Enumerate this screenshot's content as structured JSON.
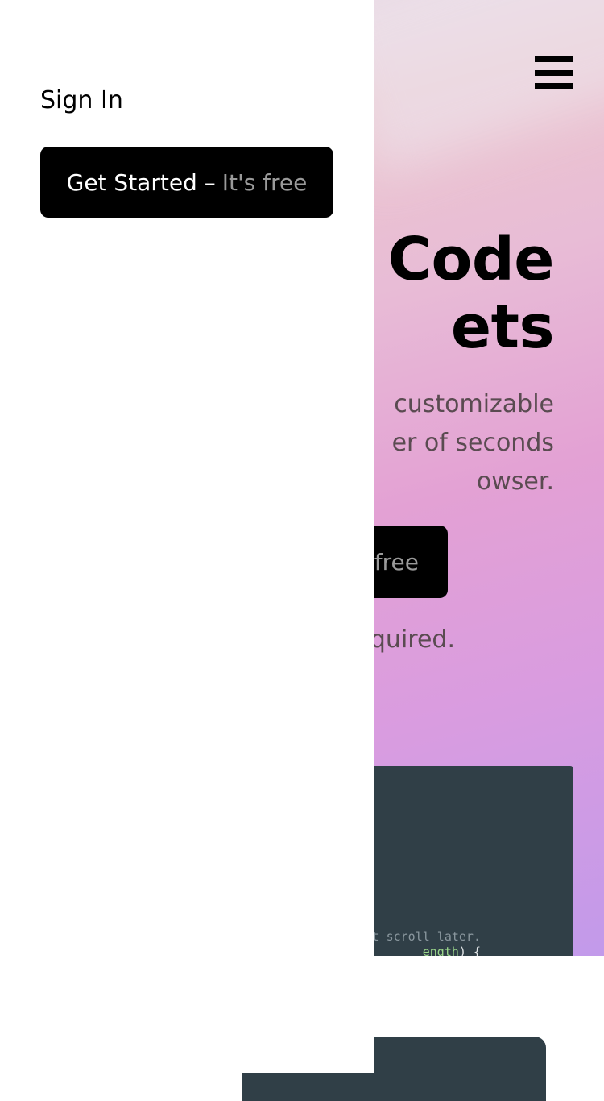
{
  "nav": {
    "menu_icon": "hamburger-menu-icon",
    "sign_in_label": "Sign In",
    "cta_main": "Get Started –",
    "cta_muted": "It's free"
  },
  "hero": {
    "title_line1": "Code",
    "title_line2": "ets",
    "subtitle_line1": "customizable",
    "subtitle_line2": "er of seconds",
    "subtitle_line3": "owser.",
    "cta_muted": "free",
    "note": "quired."
  },
  "code_preview": {
    "comment": "st scroll later.",
    "expr_prop": "ength",
    "expr_rest": ") {"
  },
  "colors": {
    "panel_bg": "#ffffff",
    "button_bg": "#000000",
    "button_muted_text": "#9a9a9a",
    "code_bg": "#303f47",
    "subtitle_text": "#5a4b51"
  }
}
